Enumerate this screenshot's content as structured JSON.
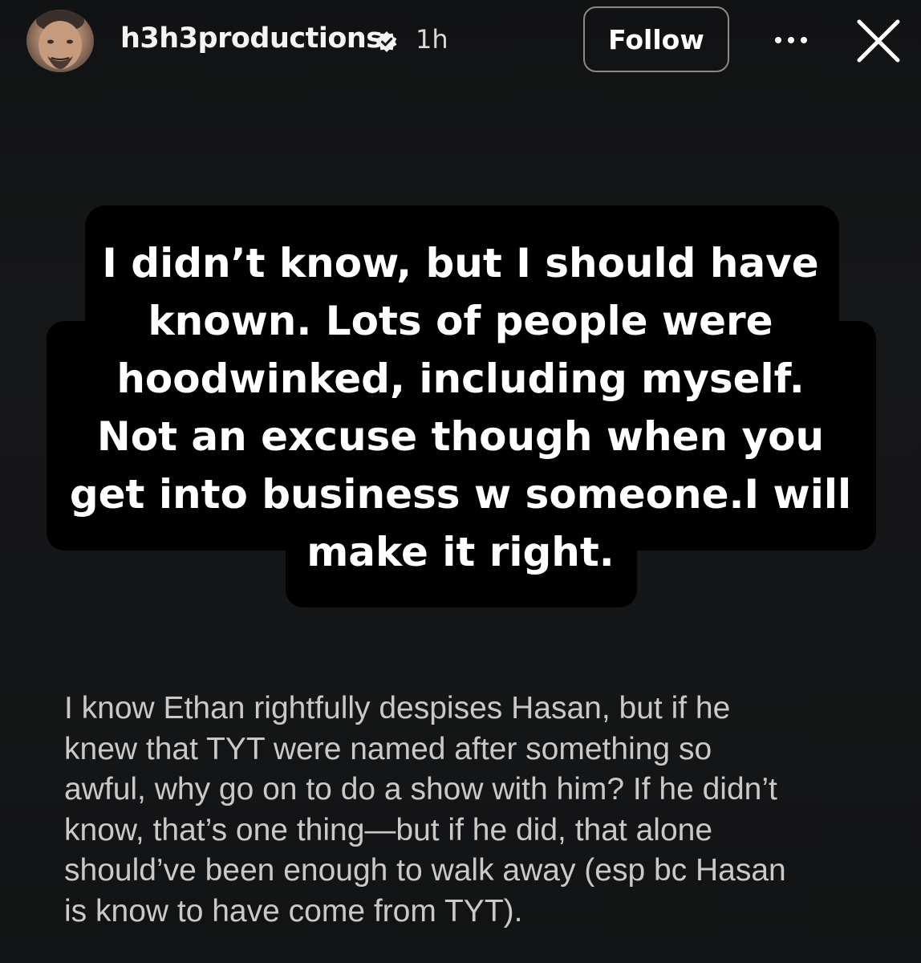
{
  "header": {
    "username": "h3h3productions",
    "timestamp": "1h",
    "follow_label": "Follow",
    "avatar_icon": "profile-avatar",
    "verified_icon": "verified-badge-icon",
    "more_icon": "more-options-icon",
    "close_icon": "close-icon"
  },
  "story": {
    "lines": [
      "I didn’t know, but I should have",
      "known. Lots of people were",
      "hoodwinked, including myself.",
      "Not an excuse though when you",
      "get into business w someone.I will",
      "make it right."
    ]
  },
  "comment": {
    "lines": [
      "I know Ethan rightfully despises Hasan, but if he",
      "knew that TYT were named after something so",
      "awful, why go on to do a show with him? If he didn’t",
      "know, that’s one thing—but if he did, that alone",
      "should’ve been enough to walk away (esp bc Hasan",
      "is know to have come from TYT)."
    ]
  },
  "colors": {
    "background": "#141516",
    "text_box": "#000000",
    "story_text": "#ffffff",
    "comment_text": "#c9c9c9"
  }
}
